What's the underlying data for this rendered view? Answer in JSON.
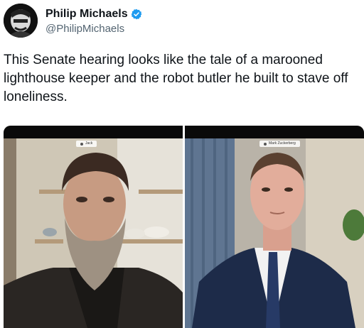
{
  "tweet": {
    "author_name": "Philip Michaels",
    "author_handle": "@PhilipMichaels",
    "verified_icon": "verified-badge-icon",
    "text": "This Senate hearing looks like the tale of a marooned lighthouse keeper and the robot butler he built to stave off loneliness."
  },
  "media": {
    "left_label": "Jack",
    "right_label": "Mark Zuckerberg"
  },
  "colors": {
    "text": "#0f1419",
    "handle": "#536471",
    "verified": "#1d9bf0"
  }
}
